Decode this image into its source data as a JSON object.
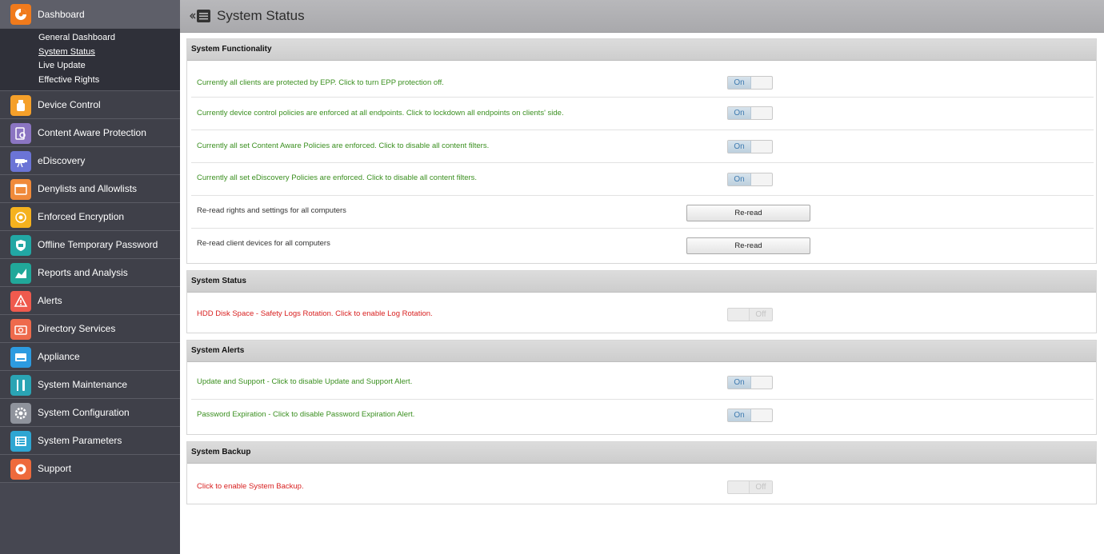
{
  "header": {
    "title": "System Status",
    "collapse_icon": "collapse-menu-icon"
  },
  "sidebar": {
    "dashboard": {
      "label": "Dashboard",
      "icon": "dashboard-icon",
      "color": "#f07a1c"
    },
    "submenu": [
      {
        "label": "General Dashboard"
      },
      {
        "label": "System Status",
        "current": true
      },
      {
        "label": "Live Update"
      },
      {
        "label": "Effective Rights"
      }
    ],
    "items": [
      {
        "label": "Device Control",
        "icon": "usb-device-icon",
        "color": "#f5a02a"
      },
      {
        "label": "Content Aware Protection",
        "icon": "content-scan-icon",
        "color": "#8b75c2"
      },
      {
        "label": "eDiscovery",
        "icon": "telescope-icon",
        "color": "#6b74d6"
      },
      {
        "label": "Denylists and Allowlists",
        "icon": "list-window-icon",
        "color": "#f08a3a"
      },
      {
        "label": "Enforced Encryption",
        "icon": "encryption-icon",
        "color": "#f5b21e"
      },
      {
        "label": "Offline Temporary Password",
        "icon": "shield-password-icon",
        "color": "#22a7a4"
      },
      {
        "label": "Reports and Analysis",
        "icon": "chart-icon",
        "color": "#21a89a"
      },
      {
        "label": "Alerts",
        "icon": "warning-icon",
        "color": "#ef5a4e"
      },
      {
        "label": "Directory Services",
        "icon": "directory-icon",
        "color": "#ee6a4c"
      },
      {
        "label": "Appliance",
        "icon": "appliance-icon",
        "color": "#2d9be0"
      },
      {
        "label": "System Maintenance",
        "icon": "tools-icon",
        "color": "#2aa4b4"
      },
      {
        "label": "System Configuration",
        "icon": "gear-icon",
        "color": "#8f939c"
      },
      {
        "label": "System Parameters",
        "icon": "parameters-list-icon",
        "color": "#2fa6d2"
      },
      {
        "label": "Support",
        "icon": "lifebuoy-icon",
        "color": "#ee6a3c"
      }
    ]
  },
  "sections": {
    "functionality": {
      "title": "System Functionality",
      "rows": [
        {
          "text": "Currently all clients are protected by EPP. Click to turn EPP protection off.",
          "state": "On"
        },
        {
          "text": "Currently device control policies are enforced at all endpoints. Click to lockdown all endpoints on clients' side.",
          "state": "On"
        },
        {
          "text": "Currently all set Content Aware Policies are enforced. Click to disable all content filters.",
          "state": "On"
        },
        {
          "text": "Currently all set eDiscovery Policies are enforced. Click to disable all content filters.",
          "state": "On"
        },
        {
          "text": "Re-read rights and settings for all computers",
          "button": "Re-read"
        },
        {
          "text": "Re-read client devices for all computers",
          "button": "Re-read"
        }
      ]
    },
    "status": {
      "title": "System Status",
      "rows": [
        {
          "text": "HDD Disk Space - Safety Logs Rotation. Click to enable Log Rotation.",
          "state": "Off"
        }
      ]
    },
    "alerts": {
      "title": "System Alerts",
      "rows": [
        {
          "text": "Update and Support - Click to disable Update and Support Alert.",
          "state": "On"
        },
        {
          "text": "Password Expiration - Click to disable Password Expiration Alert.",
          "state": "On"
        }
      ]
    },
    "backup": {
      "title": "System Backup",
      "rows": [
        {
          "text": "Click to enable System Backup.",
          "state": "Off"
        }
      ]
    }
  }
}
